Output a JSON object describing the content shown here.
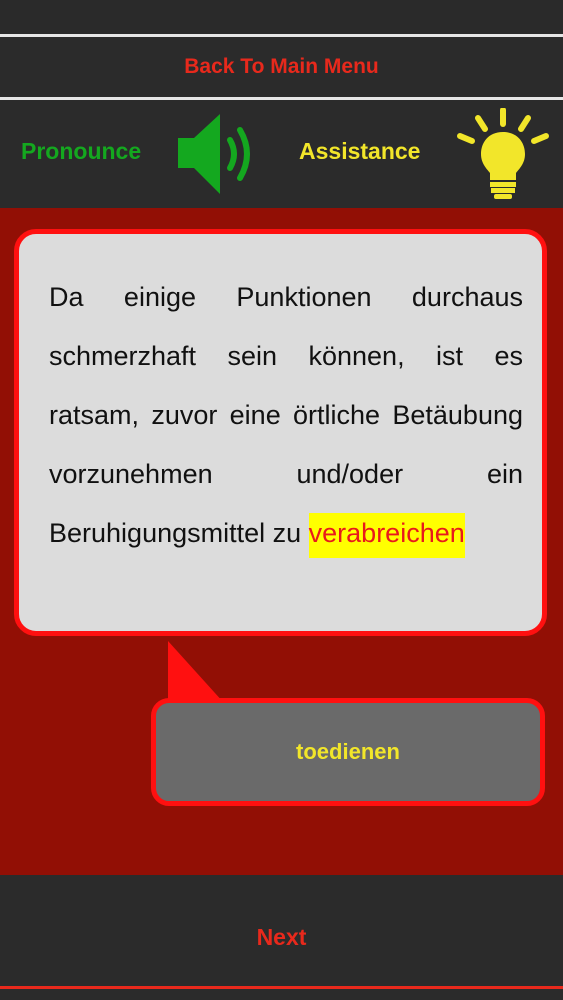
{
  "nav": {
    "back_label": "Back To Main Menu"
  },
  "toolbar": {
    "pronounce_label": "Pronounce",
    "assistance_label": "Assistance",
    "speaker_icon": "speaker-icon",
    "bulb_icon": "lightbulb-icon"
  },
  "question": {
    "sentence": "Da einige Punktionen durchaus schmerzhaft sein können, ist es ratsam, zuvor eine örtliche Betäubung vorzunehmen und/oder ein Beruhigungsmittel zu",
    "highlighted_word": "verabreichen"
  },
  "answer": {
    "label": "toedienen"
  },
  "footer": {
    "next_label": "Next"
  },
  "colors": {
    "background_dark": "#2b2b2b",
    "main_red": "#920f05",
    "border_red": "#ff1010",
    "label_red": "#e8291c",
    "pronounce_green": "#14a81f",
    "assist_yellow": "#f2e62a",
    "highlight_yellow": "#ffff00",
    "bubble_gray": "#dcdcdc",
    "button_gray": "#6a6a6a"
  }
}
